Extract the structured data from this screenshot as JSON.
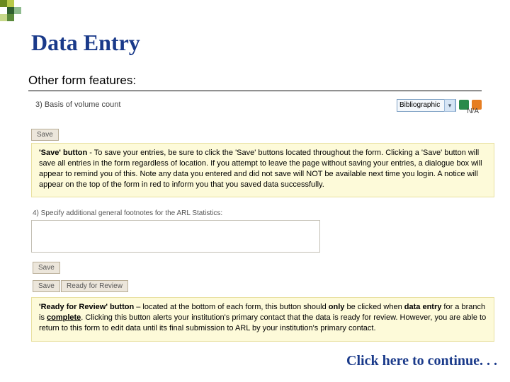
{
  "title": "Data Entry",
  "subtitle": "Other form features:",
  "q3": {
    "label": "3) Basis of volume count",
    "selected": "Bibliographic",
    "na": "N/A"
  },
  "buttons": {
    "save": "Save",
    "ready": "Ready for Review"
  },
  "note_save": {
    "lead": "'Save' button",
    "body_1": " - To save your entries, be sure to click the 'Save' buttons located throughout the form. Clicking a 'Save' button will save all entries in the form regardless of location. If you attempt to leave the page without saving your entries, a dialogue box will appear to remind you of this. Note any data you entered and did not save will NOT be available next time you login. A notice will appear on the top of the form in red to inform you that you saved data successfully."
  },
  "q4": {
    "label": "4) Specify additional general footnotes for the ARL Statistics:"
  },
  "note_ready": {
    "lead": "'Ready for Review' button",
    "body_a": " – located at the bottom of each form, this button should ",
    "only": "only",
    "body_b": " be clicked when ",
    "data_entry": "data entry",
    "body_c": " for a branch is ",
    "complete": "complete",
    "body_d": ". Clicking this button alerts your institution's primary contact that the data is ready for review. However, you are able to return to this form to edit data until its final submission to ARL by your institution's primary contact."
  },
  "continue": "Click here to continue. . ."
}
